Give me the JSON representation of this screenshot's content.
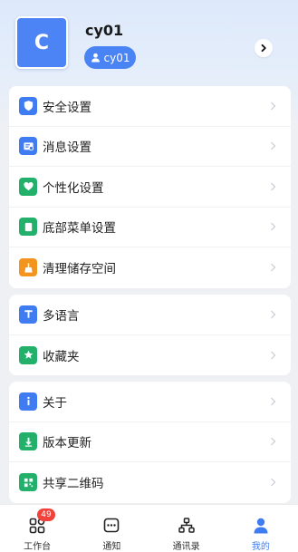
{
  "profile": {
    "avatar_letter": "C",
    "username": "cy01",
    "badge_text": "cy01"
  },
  "groups": [
    {
      "items": [
        {
          "label": "安全设置",
          "icon": "shield-icon",
          "color": "#3f7cf2"
        },
        {
          "label": "消息设置",
          "icon": "message-settings-icon",
          "color": "#3f7cf2"
        },
        {
          "label": "个性化设置",
          "icon": "heart-icon",
          "color": "#23b06b"
        },
        {
          "label": "底部菜单设置",
          "icon": "bottom-menu-icon",
          "color": "#23b06b"
        },
        {
          "label": "清理储存空间",
          "icon": "broom-icon",
          "color": "#f3941f"
        }
      ]
    },
    {
      "items": [
        {
          "label": "多语言",
          "icon": "text-t-icon",
          "color": "#3f7cf2"
        },
        {
          "label": "收藏夹",
          "icon": "star-icon",
          "color": "#23b06b"
        }
      ]
    },
    {
      "items": [
        {
          "label": "关于",
          "icon": "info-icon",
          "color": "#3f7cf2"
        },
        {
          "label": "版本更新",
          "icon": "download-icon",
          "color": "#23b06b"
        },
        {
          "label": "共享二维码",
          "icon": "qrcode-icon",
          "color": "#23b06b"
        }
      ]
    }
  ],
  "tabbar": {
    "tabs": [
      {
        "label": "工作台",
        "icon": "workbench-grid-icon",
        "badge": "49"
      },
      {
        "label": "通知",
        "icon": "notification-chat-icon"
      },
      {
        "label": "通讯录",
        "icon": "contacts-org-icon"
      },
      {
        "label": "我的",
        "icon": "user-profile-icon",
        "active": true
      }
    ]
  },
  "colors": {
    "accent": "#3f7cf2",
    "green": "#23b06b",
    "orange": "#f3941f",
    "badge_red": "#f0423a"
  }
}
